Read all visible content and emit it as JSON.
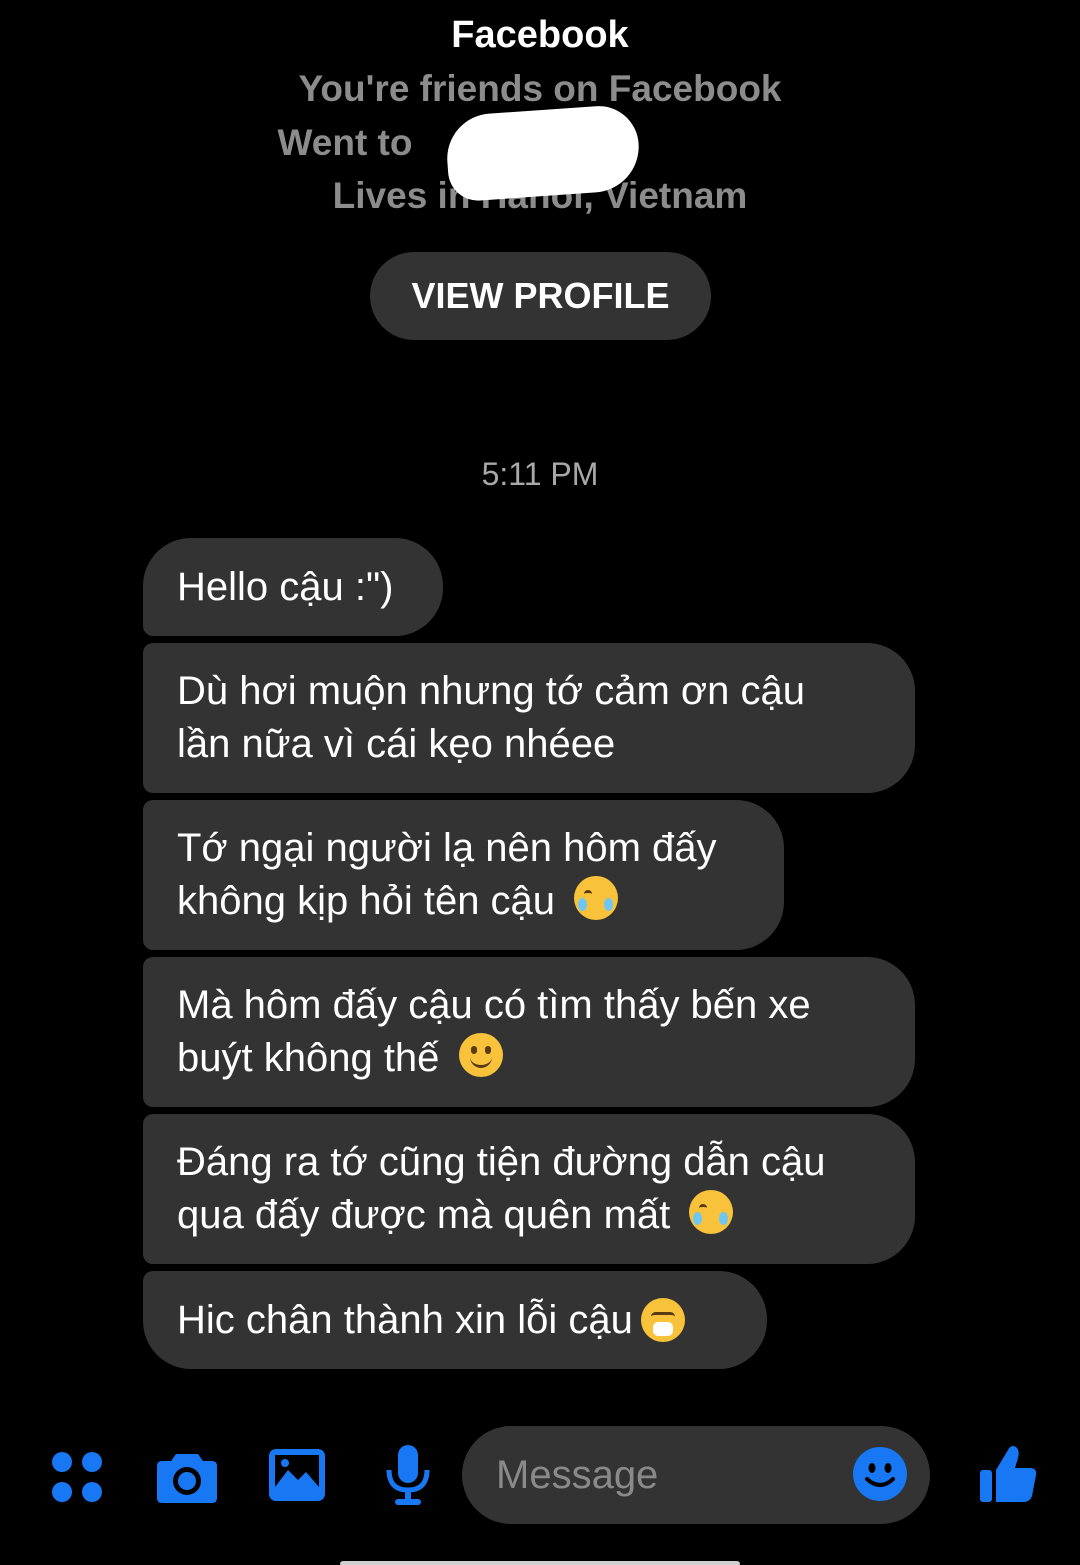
{
  "profile": {
    "name": "Facebook",
    "friends_text": "You're friends on Facebook",
    "school_text": "Went to",
    "lives_text": "Lives in Hanoi, Vietnam",
    "view_profile_label": "VIEW PROFILE"
  },
  "conversation": {
    "timestamp": "5:11 PM",
    "messages": [
      {
        "line1": "Hello cậu :\")",
        "line2": ""
      },
      {
        "line1": "Dù hơi muộn nhưng tớ cảm ơn cậu",
        "line2": "lần nữa vì cái kẹo nhéee"
      },
      {
        "line1": "Tớ ngại người lạ nên hôm đấy",
        "line2": "không kịp hỏi tên cậu",
        "emoji": "tear-smile-emoji"
      },
      {
        "line1": "Mà hôm đấy cậu có tìm thấy bến xe",
        "line2": "buýt không thế",
        "emoji": "smile-emoji"
      },
      {
        "line1": "Đáng ra tớ cũng tiện đường dẫn cậu",
        "line2": "qua đấy được mà quên mất",
        "emoji": "tear-smile-emoji"
      },
      {
        "line1": "Hic chân thành xin lỗi cậu",
        "line2": "",
        "emoji": "sneezing-face-emoji"
      }
    ]
  },
  "composer": {
    "placeholder": "Message",
    "icons": [
      "apps-icon",
      "camera-icon",
      "gallery-icon",
      "microphone-icon",
      "emoji-icon",
      "thumbs-up-icon"
    ]
  },
  "colors": {
    "background": "#000000",
    "bubble": "#333333",
    "accent": "#1877f2",
    "muted_text": "#8c8c8c"
  }
}
